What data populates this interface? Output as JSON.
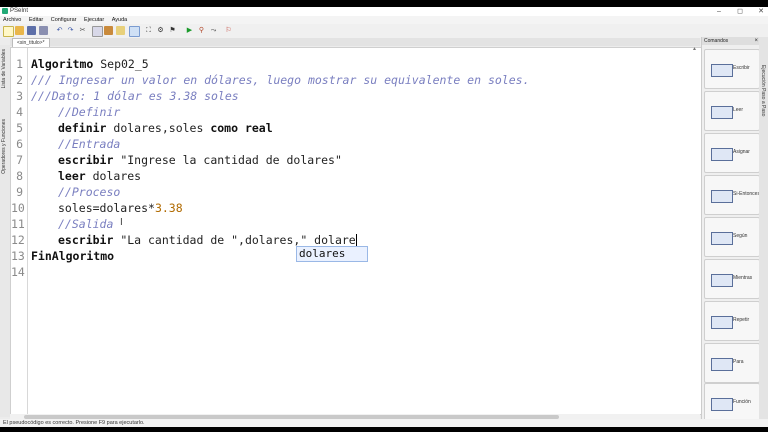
{
  "window": {
    "title": "PSeInt"
  },
  "menu": {
    "items": [
      "Archivo",
      "Editar",
      "Configurar",
      "Ejecutar",
      "Ayuda"
    ]
  },
  "tab": {
    "label": "<sin_titulo>*"
  },
  "left_panel": {
    "vars_label": "Lista de Variables",
    "ops_label": "Operadores y Funciones"
  },
  "editor": {
    "line_numbers": [
      "1",
      "2",
      "3",
      "4",
      "5",
      "6",
      "7",
      "8",
      "9",
      "10",
      "11",
      "12",
      "13",
      "14"
    ],
    "lines": {
      "l1_kw": "Algoritmo",
      "l1_name": " Sep02_5",
      "l2": "/// Ingresar un valor en dólares, luego mostrar su equivalente en soles.",
      "l3": "///Dato: 1 dólar es 3.38 soles",
      "l4": "//Definir",
      "l5_kw": "definir",
      "l5_vars": " dolares,soles ",
      "l5_kw2": "como real",
      "l6": "//Entrada",
      "l7_kw": "escribir",
      "l7_str": " \"Ingrese la cantidad de dolares\"",
      "l8_kw": "leer",
      "l8_var": " dolares",
      "l9": "//Proceso",
      "l10_expr": "soles=dolares*",
      "l10_num": "3.38",
      "l11": "//Salida",
      "l12_kw": "escribir",
      "l12_str": " \"La cantidad de \",dolares,\" dolare",
      "l13_kw": "FinAlgoritmo"
    },
    "autocomplete": {
      "suggestion": "dolares"
    }
  },
  "commands": {
    "title": "Comandos",
    "items": [
      "Escribir",
      "Leer",
      "Asignar",
      "Si-Entonces",
      "Según",
      "Mientras",
      "Repetir",
      "Para",
      "Función"
    ]
  },
  "right_strip": {
    "label": "Ejecución Paso a Paso"
  },
  "status": {
    "text": "El pseudocódigo es correcto. Presione F9 para ejecutarlo."
  },
  "colors": {
    "comment": "#7a7fc0",
    "number": "#b06a00",
    "autocomplete_bg": "#eaf1ff"
  }
}
